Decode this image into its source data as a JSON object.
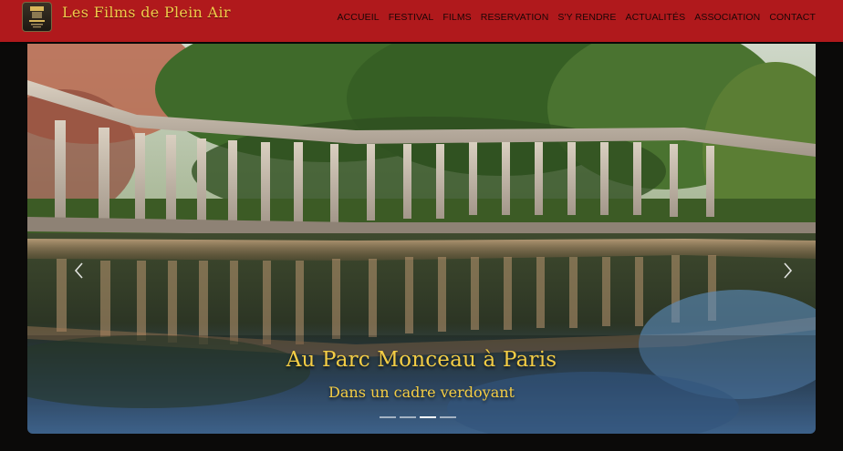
{
  "header": {
    "brand": "Les Films de Plein Air",
    "logo_icon": "film-poster-logo",
    "background_color": "#b0191c",
    "brand_color": "#f1c94a"
  },
  "nav": {
    "items": [
      {
        "label": "ACCUEIL"
      },
      {
        "label": "FESTIVAL"
      },
      {
        "label": "FILMS"
      },
      {
        "label": "RESERVATION"
      },
      {
        "label": "S'Y RENDRE"
      },
      {
        "label": "ACTUALITÉS"
      },
      {
        "label": "ASSOCIATION"
      },
      {
        "label": "CONTACT"
      }
    ]
  },
  "hero": {
    "title": "Au Parc Monceau à Paris",
    "subtitle": "Dans un cadre verdoyant",
    "prev_icon": "chevron-left-icon",
    "next_icon": "chevron-right-icon",
    "slide_count": 4,
    "active_slide": 3,
    "caption_color": "#f4cd45"
  }
}
